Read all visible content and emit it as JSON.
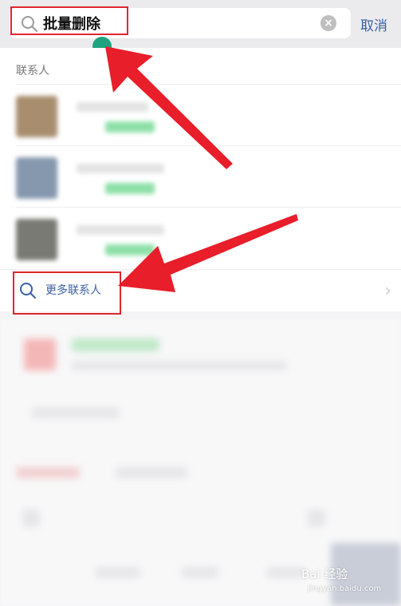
{
  "search": {
    "value": "批量删除",
    "cancel_label": "取消"
  },
  "contacts": {
    "section_title": "联系人",
    "more_label": "更多联系人"
  },
  "watermark": {
    "brand": "Bai 经验",
    "url": "jingyan.baidu.com"
  },
  "colors": {
    "annotation_red": "#e0262d",
    "link_blue": "#3a5fa3",
    "accent_teal": "#1fa380"
  },
  "icons": [
    "search-icon",
    "clear-icon",
    "chevron-right-icon",
    "annotation-arrow"
  ]
}
